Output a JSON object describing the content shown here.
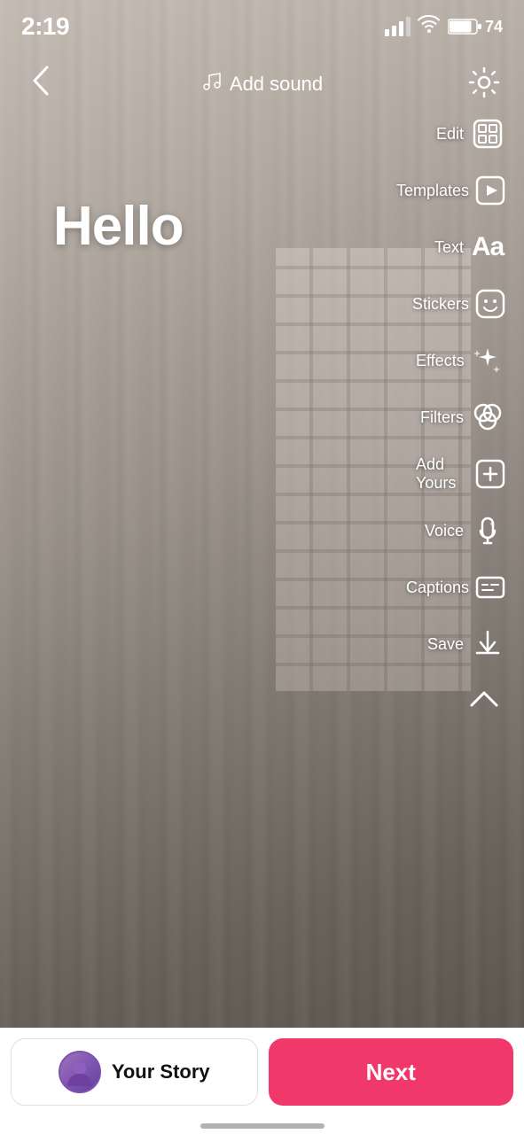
{
  "status": {
    "time": "2:19",
    "battery": "74"
  },
  "top_bar": {
    "add_sound_label": "Add sound",
    "back_label": "back"
  },
  "content": {
    "hello_text": "Hello"
  },
  "toolbar": {
    "items": [
      {
        "id": "edit",
        "label": "Edit",
        "icon": "edit-icon"
      },
      {
        "id": "templates",
        "label": "Templates",
        "icon": "templates-icon"
      },
      {
        "id": "text",
        "label": "Text",
        "icon": "text-icon"
      },
      {
        "id": "stickers",
        "label": "Stickers",
        "icon": "stickers-icon"
      },
      {
        "id": "effects",
        "label": "Effects",
        "icon": "effects-icon"
      },
      {
        "id": "filters",
        "label": "Filters",
        "icon": "filters-icon"
      },
      {
        "id": "addyours",
        "label": "Add Yours",
        "icon": "addyours-icon"
      },
      {
        "id": "voice",
        "label": "Voice",
        "icon": "voice-icon"
      },
      {
        "id": "captions",
        "label": "Captions",
        "icon": "captions-icon"
      },
      {
        "id": "save",
        "label": "Save",
        "icon": "save-icon"
      }
    ],
    "collapse_label": "collapse"
  },
  "bottom_bar": {
    "your_story_label": "Your Story",
    "next_label": "Next"
  },
  "colors": {
    "next_button_bg": "#F0386A",
    "toolbar_label_color": "#ffffff"
  }
}
